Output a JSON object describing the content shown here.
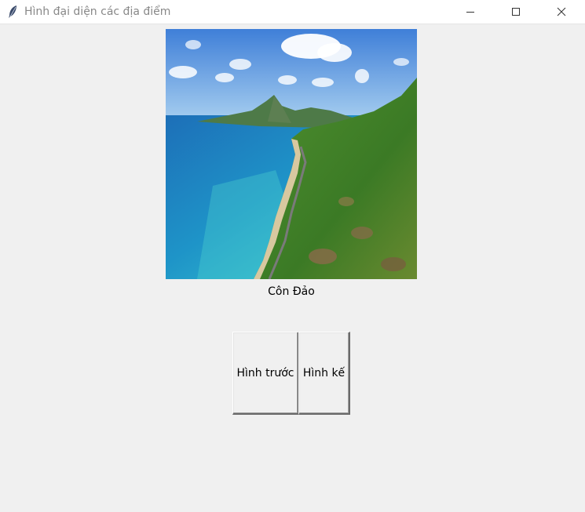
{
  "window": {
    "title": "Hình đại diện các địa điểm",
    "app_icon": "feather-icon",
    "controls": [
      "minimize-icon",
      "maximize-icon",
      "close-icon"
    ]
  },
  "photo": {
    "caption": "Côn Đảo"
  },
  "buttons": {
    "prev_label": "Hình trước",
    "next_label": "Hình kế"
  },
  "colors": {
    "window_bg": "#f0f0f0",
    "titlebar_bg": "#ffffff",
    "title_text": "#888888"
  }
}
